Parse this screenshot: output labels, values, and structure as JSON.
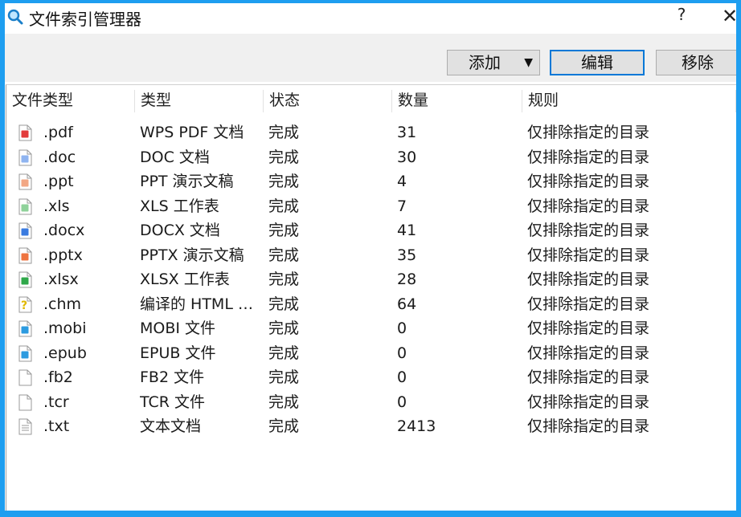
{
  "window": {
    "title": "文件索引管理器",
    "help": "?",
    "close": "✕"
  },
  "toolbar": {
    "add_label": "添加",
    "add_caret": "▼",
    "edit_label": "编辑",
    "remove_label": "移除"
  },
  "columns": [
    "文件类型",
    "类型",
    "状态",
    "数量",
    "规则"
  ],
  "rows": [
    {
      "ext": ".pdf",
      "type": "WPS PDF 文档",
      "status": "完成",
      "count": "31",
      "rule": "仅排除指定的目录",
      "icon": "pdf-file-icon",
      "color": "#e23b3b"
    },
    {
      "ext": ".doc",
      "type": "DOC 文档",
      "status": "完成",
      "count": "30",
      "rule": "仅排除指定的目录",
      "icon": "doc-file-icon",
      "color": "#8fb4f0"
    },
    {
      "ext": ".ppt",
      "type": "PPT 演示文稿",
      "status": "完成",
      "count": "4",
      "rule": "仅排除指定的目录",
      "icon": "ppt-file-icon",
      "color": "#f2a784"
    },
    {
      "ext": ".xls",
      "type": "XLS 工作表",
      "status": "完成",
      "count": "7",
      "rule": "仅排除指定的目录",
      "icon": "xls-file-icon",
      "color": "#8fd29a"
    },
    {
      "ext": ".docx",
      "type": "DOCX 文档",
      "status": "完成",
      "count": "41",
      "rule": "仅排除指定的目录",
      "icon": "docx-file-icon",
      "color": "#3a7be0"
    },
    {
      "ext": ".pptx",
      "type": "PPTX 演示文稿",
      "status": "完成",
      "count": "35",
      "rule": "仅排除指定的目录",
      "icon": "pptx-file-icon",
      "color": "#ee7440"
    },
    {
      "ext": ".xlsx",
      "type": "XLSX 工作表",
      "status": "完成",
      "count": "28",
      "rule": "仅排除指定的目录",
      "icon": "xlsx-file-icon",
      "color": "#2fa84a"
    },
    {
      "ext": ".chm",
      "type": "编译的 HTML 帮助文件",
      "status": "完成",
      "count": "64",
      "rule": "仅排除指定的目录",
      "icon": "chm-file-icon",
      "color": "#e0b800"
    },
    {
      "ext": ".mobi",
      "type": "MOBI 文件",
      "status": "完成",
      "count": "0",
      "rule": "仅排除指定的目录",
      "icon": "mobi-file-icon",
      "color": "#2c9be0"
    },
    {
      "ext": ".epub",
      "type": "EPUB 文件",
      "status": "完成",
      "count": "0",
      "rule": "仅排除指定的目录",
      "icon": "epub-file-icon",
      "color": "#2c9be0"
    },
    {
      "ext": ".fb2",
      "type": "FB2 文件",
      "status": "完成",
      "count": "0",
      "rule": "仅排除指定的目录",
      "icon": "fb2-file-icon",
      "color": "#ffffff"
    },
    {
      "ext": ".tcr",
      "type": "TCR 文件",
      "status": "完成",
      "count": "0",
      "rule": "仅排除指定的目录",
      "icon": "tcr-file-icon",
      "color": "#ffffff"
    },
    {
      "ext": ".txt",
      "type": "文本文档",
      "status": "完成",
      "count": "2413",
      "rule": "仅排除指定的目录",
      "icon": "txt-file-icon",
      "color": "#c8c8c8"
    }
  ]
}
